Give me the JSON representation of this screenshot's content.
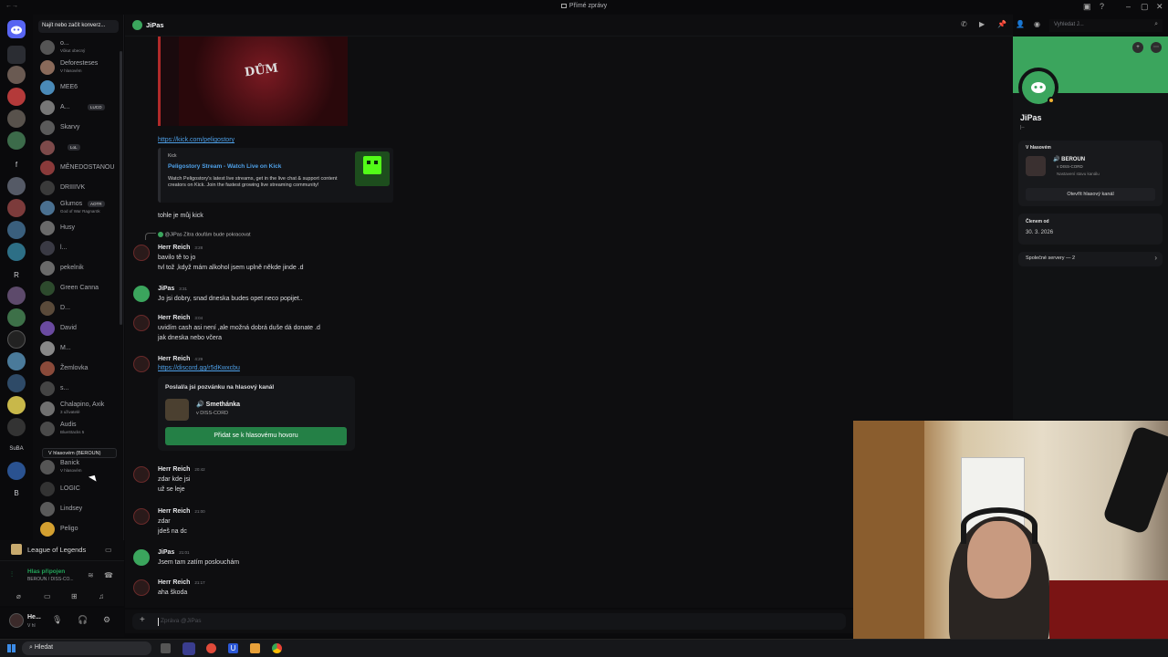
{
  "window": {
    "title": "Přímé zprávy"
  },
  "dm_list": {
    "search_placeholder": "Najít nebo začít konverz...",
    "items": [
      {
        "name": "o...",
        "status": "Vůkut obecný"
      },
      {
        "name": "Deforesteses",
        "status": "V hlasovém"
      },
      {
        "name": "MEE6",
        "status": ""
      },
      {
        "name": "A...",
        "status": "",
        "badge": "LUCO"
      },
      {
        "name": "Skarvy",
        "status": ""
      },
      {
        "name": "",
        "status": "",
        "badge": "LoL"
      },
      {
        "name": "MĚNEDOSTANOU",
        "status": ""
      },
      {
        "name": "DRIIIIVK",
        "status": ""
      },
      {
        "name": "Glumos",
        "status": "God of War Ragnarök",
        "badge": "AOTR"
      },
      {
        "name": "Husy",
        "status": ""
      },
      {
        "name": "l...",
        "status": ""
      },
      {
        "name": "pekelnik",
        "status": ""
      },
      {
        "name": "Green Canna",
        "status": ""
      },
      {
        "name": "D...",
        "status": ""
      },
      {
        "name": "David",
        "status": ""
      },
      {
        "name": "M...",
        "status": ""
      },
      {
        "name": "Žemlovka",
        "status": ""
      },
      {
        "name": "s...",
        "status": ""
      },
      {
        "name": "Chalapino, Axik",
        "status": "3 uživatelé"
      },
      {
        "name": "Audis",
        "status": "BlueStacks 5"
      },
      {
        "name": "Banick",
        "status": "V hlasovém"
      },
      {
        "name": "LOGIC",
        "status": ""
      },
      {
        "name": "Lindsey",
        "status": ""
      },
      {
        "name": "Peligo",
        "status": ""
      }
    ],
    "voice_tooltip": "V hlasovém (BEROUN)"
  },
  "servers": {
    "labels": [
      "f",
      "R",
      "SuBA",
      "B"
    ]
  },
  "game_activity": {
    "name": "League of Legends"
  },
  "voice_panel": {
    "status": "Hlas připojen",
    "channel": "BEROUN / DISS-CO..."
  },
  "user_panel": {
    "name": "He...",
    "status": "V hl"
  },
  "chat": {
    "header_name": "JiPas",
    "search_placeholder": "Vyhledat J...",
    "composer_placeholder": "Zpráva @JiPas",
    "kick_link": "https://kick.com/peligostory",
    "embed": {
      "provider": "Kick",
      "title": "Peligostory Stream - Watch Live on Kick",
      "description": "Watch Peligostory's latest live streams, get in the live chat & support content creators on Kick. Join the fastest growing live streaming community!"
    },
    "standalone_line": "tohle je můj kick",
    "reply_ref": {
      "author": "@JiPas",
      "text": "Zítra doufám bude pokracovat"
    },
    "messages": [
      {
        "author": "Herr Reich",
        "time": "3:28",
        "lines": [
          "bavilo tě to jo",
          "tvl tož ,když mám alkohol jsem uplně někde jinde .d"
        ]
      },
      {
        "author": "JiPas",
        "time": "3:31",
        "lines": [
          "Jo jsi dobry, snad dneska budes opet neco popijet.."
        ]
      },
      {
        "author": "Herr Reich",
        "time": "3:04",
        "lines": [
          "uvidím cash asi není ,ale možná dobrá duše dá donate .d",
          "jak dneska nebo včera"
        ]
      },
      {
        "author": "Herr Reich",
        "time": "4:29",
        "lines": []
      },
      {
        "author": "Herr Reich",
        "time": "20:42",
        "lines": [
          "zdar kde jsi",
          "už se leje"
        ]
      },
      {
        "author": "Herr Reich",
        "time": "21:00",
        "lines": [
          "zdar",
          "jdeš na dc"
        ]
      },
      {
        "author": "JiPas",
        "time": "21:01",
        "lines": [
          "Jsem tam zatím poslouchám"
        ]
      },
      {
        "author": "Herr Reich",
        "time": "21:17",
        "lines": [
          "aha škoda"
        ]
      }
    ],
    "invite": {
      "link": "https://discord.gg/r5dKwxcbu",
      "heading": "Poslal/a jsi pozvánku na hlasový kanál",
      "channel": "Smethánka",
      "server": "v DISS-CORD",
      "button": "Přidat se k hlasovému hovoru"
    }
  },
  "profile": {
    "name": "JiPas",
    "tag": "|--",
    "voice_section": "V hlasovém",
    "voice_channel": "BEROUN",
    "voice_server": "v DISS-CORD",
    "voice_sub": "Nastavení stavu kanálu",
    "open_channel": "Otevřít hlasový kanál",
    "member_since_label": "Členem od",
    "member_since": "30. 3. 2026",
    "mutual_servers": "Společné servery — 2"
  },
  "taskbar": {
    "search": "Hledat"
  },
  "colors": {
    "accent_green": "#3ba55d",
    "banner": "#3ba55d",
    "link": "#4ea0e8",
    "join_button": "#248046"
  }
}
